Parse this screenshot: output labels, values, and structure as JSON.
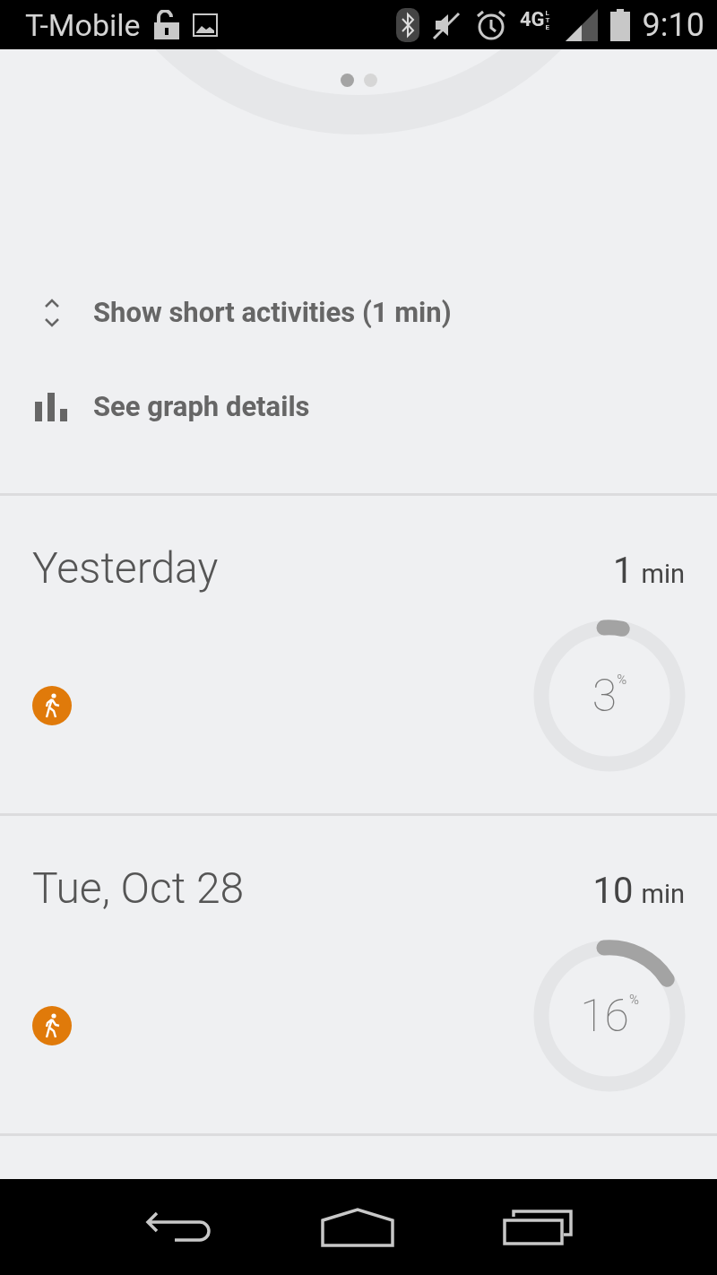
{
  "status_bar": {
    "carrier": "T-Mobile",
    "network": "4G",
    "network_sub": "LTE",
    "time": "9:10"
  },
  "pager": [
    {
      "selected": true
    },
    {
      "selected": false
    }
  ],
  "options": [
    {
      "kind": "expand",
      "label": "Show short activities (1 min)"
    },
    {
      "kind": "graph",
      "label": "See graph details"
    }
  ],
  "days": [
    {
      "date": "Yesterday",
      "duration": "1",
      "unit": "min",
      "percent": "3",
      "percent_sign": "%",
      "activities": [
        {
          "kind": "walking"
        }
      ]
    },
    {
      "date": "Tue, Oct 28",
      "duration": "10",
      "unit": "min",
      "percent": "16",
      "percent_sign": "%",
      "activities": [
        {
          "kind": "walking"
        }
      ]
    }
  ]
}
